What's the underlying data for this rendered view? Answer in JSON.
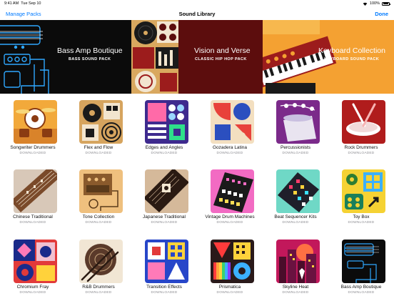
{
  "status_bar": {
    "time": "9:41 AM",
    "date": "Tue Sep 10",
    "battery": "100%"
  },
  "nav": {
    "left_label": "Manage Packs",
    "title": "Sound Library",
    "done_label": "Done"
  },
  "banners": [
    {
      "title": "Bass Amp Boutique",
      "subtitle": "BASS SOUND PACK"
    },
    {
      "title": "Vision and Verse",
      "subtitle": "CLASSIC HIP HOP PACK"
    },
    {
      "title": "Keyboard Collection",
      "subtitle": "KEYBOARD SOUND PACK"
    }
  ],
  "packs": [
    {
      "name": "Songwriter Drummers",
      "status": "DOWNLOADED",
      "icon": "drum-kit-icon",
      "color": "#f2a93b"
    },
    {
      "name": "Flex and Flow",
      "status": "DOWNLOADED",
      "icon": "turntable-icon",
      "color": "#d6a45e"
    },
    {
      "name": "Edges and Angles",
      "status": "DOWNLOADED",
      "icon": "drum-pads-icon",
      "color": "#3e2a8e"
    },
    {
      "name": "Gozadera Latina",
      "status": "DOWNLOADED",
      "icon": "latin-shapes-icon",
      "color": "#f3dfc0"
    },
    {
      "name": "Percussionists",
      "status": "DOWNLOADED",
      "icon": "conga-drum-icon",
      "color": "#7b2a8a"
    },
    {
      "name": "Rock Drummers",
      "status": "DOWNLOADED",
      "icon": "drumsticks-icon",
      "color": "#b01c1c"
    },
    {
      "name": "Chinese Traditional",
      "status": "DOWNLOADED",
      "icon": "guzheng-icon",
      "color": "#d8c8b8"
    },
    {
      "name": "Tone Collection",
      "status": "DOWNLOADED",
      "icon": "amp-icon",
      "color": "#efc07e"
    },
    {
      "name": "Japanese Traditional",
      "status": "DOWNLOADED",
      "icon": "koto-icon",
      "color": "#d5b99a"
    },
    {
      "name": "Vintage Drum Machines",
      "status": "DOWNLOADED",
      "icon": "drum-machine-icon",
      "color": "#f26bc3"
    },
    {
      "name": "Beat Sequencer Kits",
      "status": "DOWNLOADED",
      "icon": "sequencer-icon",
      "color": "#6fd8c6"
    },
    {
      "name": "Toy Box",
      "status": "DOWNLOADED",
      "icon": "toy-box-icon",
      "color": "#f5d233"
    },
    {
      "name": "Chromium Fray",
      "status": "DOWNLOADED",
      "icon": "chromium-shapes-icon",
      "color": "#e23a3a"
    },
    {
      "name": "R&B Drummers",
      "status": "DOWNLOADED",
      "icon": "snare-drum-icon",
      "color": "#f1e6d4"
    },
    {
      "name": "Transition Effects",
      "status": "DOWNLOADED",
      "icon": "effects-grid-icon",
      "color": "#2746c9"
    },
    {
      "name": "Prismatica",
      "status": "DOWNLOADED",
      "icon": "prism-icon",
      "color": "#2a1a1a"
    },
    {
      "name": "Skyline Heat",
      "status": "DOWNLOADED",
      "icon": "skyline-icon",
      "color": "#c2185b"
    },
    {
      "name": "Bass Amp Boutique",
      "status": "DOWNLOADED",
      "icon": "bass-guitar-icon",
      "color": "#0b0b0b"
    }
  ]
}
